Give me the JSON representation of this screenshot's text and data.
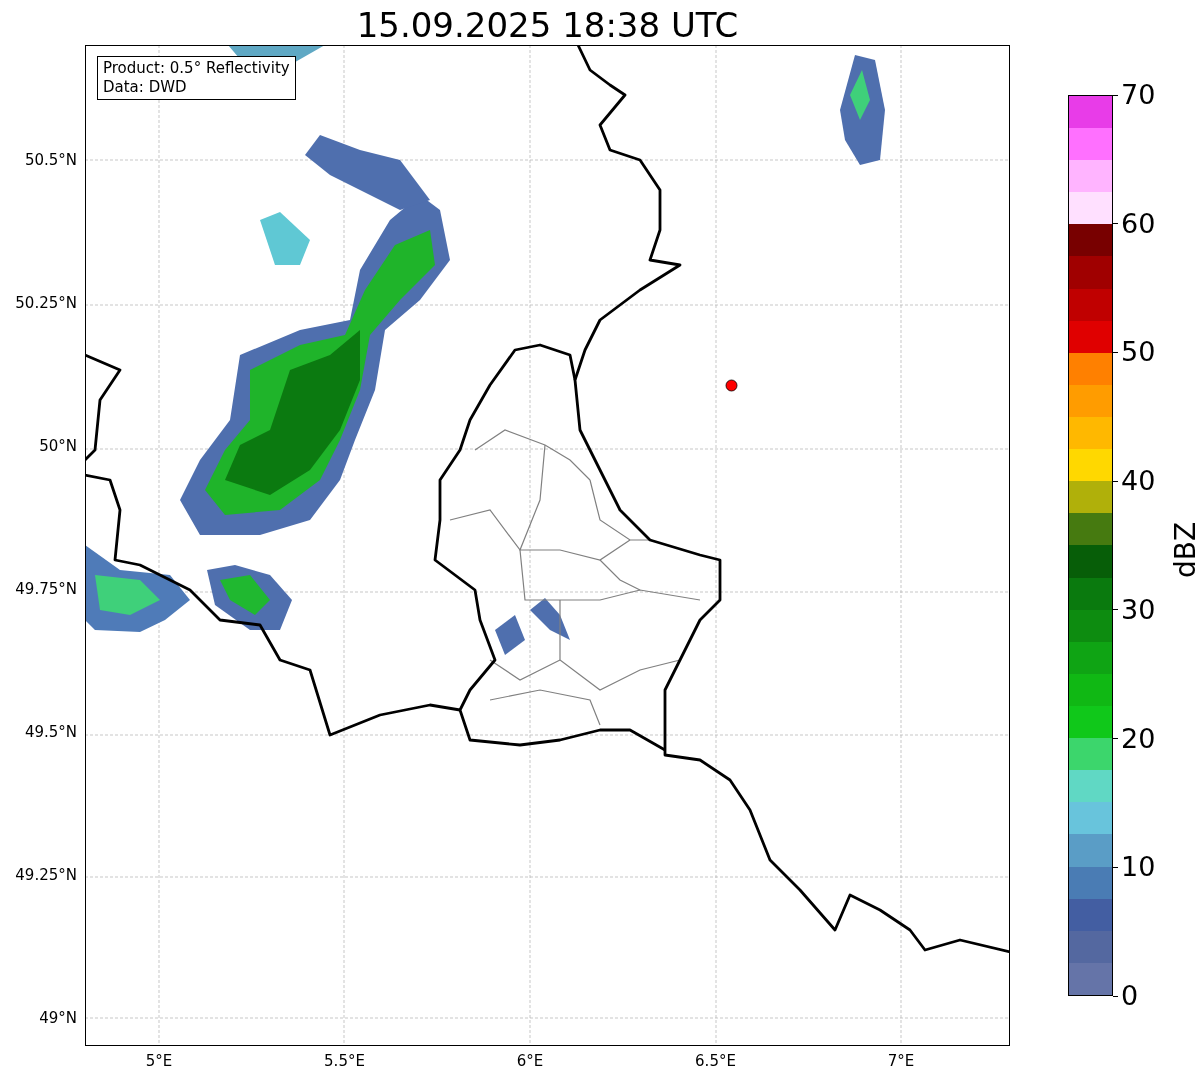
{
  "title": "15.09.2025 18:38 UTC",
  "legend": [
    "Product: 0.5° Reflectivity",
    "Data: DWD"
  ],
  "lat_ticks": [
    "50.5°N",
    "50.25°N",
    "50°N",
    "49.75°N",
    "49.5°N",
    "49.25°N",
    "49°N"
  ],
  "lon_ticks": [
    "5°E",
    "5.5°E",
    "6°E",
    "6.5°E",
    "7°E"
  ],
  "colorbar": {
    "label": "dBZ",
    "ticks": [
      "70",
      "60",
      "50",
      "40",
      "30",
      "20",
      "10",
      "0"
    ],
    "bands": [
      {
        "color": "#6574a8"
      },
      {
        "color": "#5468a0"
      },
      {
        "color": "#435ea2"
      },
      {
        "color": "#4a7cb4"
      },
      {
        "color": "#5a9dc6"
      },
      {
        "color": "#68c4dc"
      },
      {
        "color": "#60d8c4"
      },
      {
        "color": "#3cd66c"
      },
      {
        "color": "#10c81a"
      },
      {
        "color": "#10b814"
      },
      {
        "color": "#0fa414"
      },
      {
        "color": "#0d8c10"
      },
      {
        "color": "#0a7a0e"
      },
      {
        "color": "#075e08"
      },
      {
        "color": "#467a10"
      },
      {
        "color": "#b0b00a"
      },
      {
        "color": "#ffd800"
      },
      {
        "color": "#ffb800"
      },
      {
        "color": "#ff9c00"
      },
      {
        "color": "#ff8000"
      },
      {
        "color": "#e00000"
      },
      {
        "color": "#c00000"
      },
      {
        "color": "#a00000"
      },
      {
        "color": "#780000"
      },
      {
        "color": "#ffe0ff"
      },
      {
        "color": "#ffb4ff"
      },
      {
        "color": "#ff70ff"
      },
      {
        "color": "#e83ce8"
      }
    ]
  }
}
